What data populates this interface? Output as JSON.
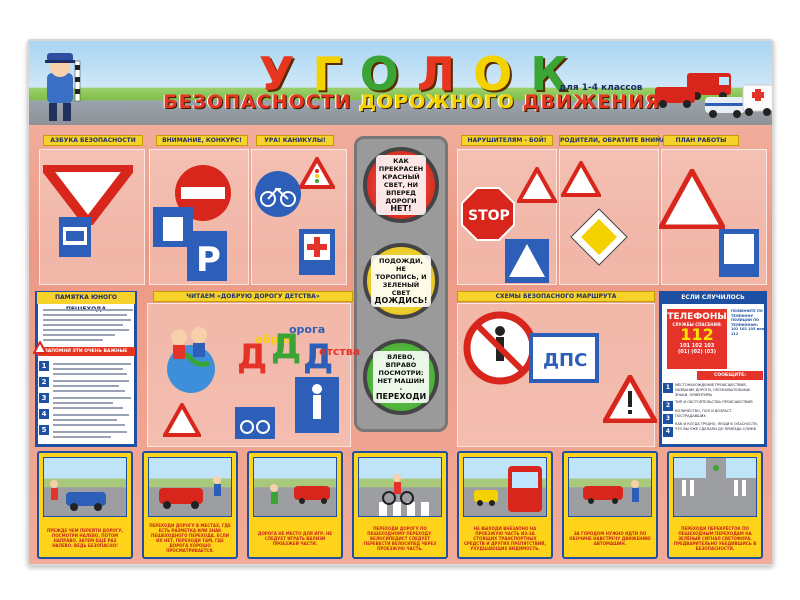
{
  "header": {
    "title_letters": [
      "У",
      "Г",
      "О",
      "Л",
      "О",
      "К"
    ],
    "title_colors": [
      "#e63620",
      "#f4d200",
      "#3aa535",
      "#e63620",
      "#f4d200",
      "#3aa535"
    ],
    "subtitle_word1": "БЕЗОПАСНОСТИ",
    "subtitle_word2": "ДОРОЖНОГО",
    "subtitle_word3": "ДВИЖЕНИЯ",
    "grade": "для 1-4 классов"
  },
  "sections": {
    "top_labels": [
      "АЗБУКА БЕЗОПАСНОСТИ",
      "ВНИМАНИЕ, КОНКУРС!",
      "УРА! КАНИКУЛЫ!",
      "НАРУШИТЕЛЯМ - БОЙ!",
      "РОДИТЕЛИ, ОБРАТИТЕ ВНИМАНИЕ!",
      "ПЛАН РАБОТЫ"
    ],
    "reading_label": "ЧИТАЕМ «ДОБРУЮ ДОРОГУ ДЕТСТВА»",
    "route_label": "СХЕМЫ БЕЗОПАСНОГО МАРШРУТА"
  },
  "traffic_light": {
    "red_text": "КАК ПРЕКРАСЕН КРАСНЫЙ СВЕТ, НИ ВПЕРЕД ДОРОГИ",
    "red_big": "НЕТ!",
    "yellow_text": "ПОДОЖДИ, НЕ ТОРОПИСЬ, И ЗЕЛЕНЫЙ СВЕТ",
    "yellow_big": "ДОЖДИСЬ!",
    "green_text": "ВЛЕВО, ВПРАВО ПОСМОТРИ: НЕТ МАШИН -",
    "green_big": "ПЕРЕХОДИ"
  },
  "memo": {
    "title": "ПАМЯТКА ЮНОГО ПЕШЕХОДА",
    "subtitle": "ЗАПОМНИ ЭТИ ОЧЕНЬ ВАЖНЫЕ ПРАВИЛА",
    "numbers": [
      "1",
      "2",
      "3",
      "4",
      "5"
    ]
  },
  "newspaper": {
    "logo_letters": [
      "Д",
      "Д",
      "Д"
    ],
    "logo_words": [
      "обрая",
      "орога",
      "етства"
    ]
  },
  "phones": {
    "title": "ЕСЛИ СЛУЧИЛОСЬ НЕСЧАСТЬЕ...",
    "card_title": "ТЕЛЕФОНЫ",
    "card_sub": "СЛУЖБЫ СПАСЕНИЯ:",
    "card_number": "112",
    "card_codes": "101 102 103",
    "card_codes2": "(01) (02) (03)",
    "message": "СООБЩИТЕ:",
    "side_text": "ПОЗВОНИТЕ ПО ТЕЛЕФОНУ ПОЛИЦИИ ПО ТЕЛЕФОНАМ: 101 102 103 или 112",
    "list": [
      "МЕСТОНАХОЖДЕНИЕ ПРОИСШЕСТВИЯ, НАЗВАНИЕ ДОРОГИ, ОПОЗНАВАТЕЛЬНЫЕ ЗНАКИ, ОРИЕНТИРЫ",
      "ТИП И ОБСТОЯТЕЛЬСТВА ПРОИСШЕСТВИЯ",
      "КОЛИЧЕСТВО, ПОЛ И ВОЗРАСТ ПОСТРАДАВШИХ",
      "КАК И КОГДА ТРУДНО, ЛЮДИ В ОПАСНОСТИ, ЧТО ВЫ УЖЕ СДЕЛАЛИ ДО ПРИЕЗДА СЛУЖБ"
    ]
  },
  "cards": [
    "ПРЕЖДЕ ЧЕМ ПЕРЕЙТИ ДОРОГУ, ПОСМОТРИ НАЛЕВО, ПОТОМ НАПРАВО. ЗАТЕМ ЕЩЁ РАЗ НАЛЕВО. ВЕДЬ БЕЗОПАСНО!",
    "ПЕРЕХОДИ ДОРОГУ В МЕСТАХ, ГДЕ ЕСТЬ РАЗМЕТКА ИЛИ ЗНАК ПЕШЕХОДНОГО ПЕРЕХОДА. ЕСЛИ ИХ НЕТ, ПЕРЕХОДИ ТАМ, ГДЕ ДОРОГА ХОРОШО ПРОСМАТРИВАЕТСЯ.",
    "ДОРОГА НЕ МЕСТО ДЛЯ ИГР. НЕ СЛЕДУЕТ ИГРАТЬ ВБЛИЗИ ПРОЕЗЖЕЙ ЧАСТИ.",
    "ПЕРЕХОДИ ДОРОГУ ПО ПЕШЕХОДНОМУ ПЕРЕХОДУ. ВЕЛОСИПЕДИСТ СЛЕДУЕТ ПЕРЕВЕСТИ ВЕЛОСИПЕД ЧЕРЕЗ ПРОЕЗЖУЮ ЧАСТЬ.",
    "НЕ ВЫХОДИ ВНЕЗАПНО НА ПРОЕЗЖУЮ ЧАСТЬ ИЗ-ЗА СТОЯЩИХ ТРАНСПОРТНЫХ СРЕДСТВ И ДРУГИХ ПРЕПЯТСТВИЙ, УХУДШАЮЩИХ ВИДИМОСТЬ.",
    "ЗА ГОРОДОМ НУЖНО ИДТИ ПО ОБОЧИНЕ НАВСТРЕЧУ ДВИЖЕНИЮ АВТОМАШИН.",
    "ПЕРЕХОДИ ПЕРЕКРЁСТОК ПО ПЕШЕХОДНЫМ ПЕРЕХОДАМ НА ЗЕЛЁНЫЙ СИГНАЛ СВЕТОФОРА, ПРЕДВАРИТЕЛЬНО УБЕДИВШИСЬ В БЕЗОПАСНОСТИ."
  ],
  "sign_texts": {
    "stop": "STOP",
    "dps": "ДПС"
  },
  "colors": {
    "accent_yellow": "#f7d22a",
    "accent_blue": "#1d4fa3",
    "accent_red": "#e63620"
  }
}
